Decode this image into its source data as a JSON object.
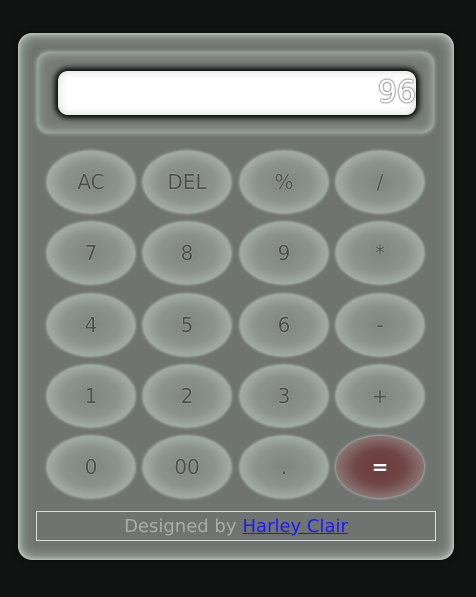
{
  "display": {
    "value": "96"
  },
  "keypad": {
    "rows": [
      [
        "AC",
        "DEL",
        "%",
        "/"
      ],
      [
        "7",
        "8",
        "9",
        "*"
      ],
      [
        "4",
        "5",
        "6",
        "-"
      ],
      [
        "1",
        "2",
        "3",
        "+"
      ],
      [
        "0",
        "00",
        ".",
        "="
      ]
    ]
  },
  "footer": {
    "prefix": "Designed by",
    "author_link": "Harley Clair"
  },
  "colors": {
    "background": "#111212",
    "body": "#6f7470",
    "equals_key": "#6b3a3b",
    "link": "#1a1aff"
  }
}
